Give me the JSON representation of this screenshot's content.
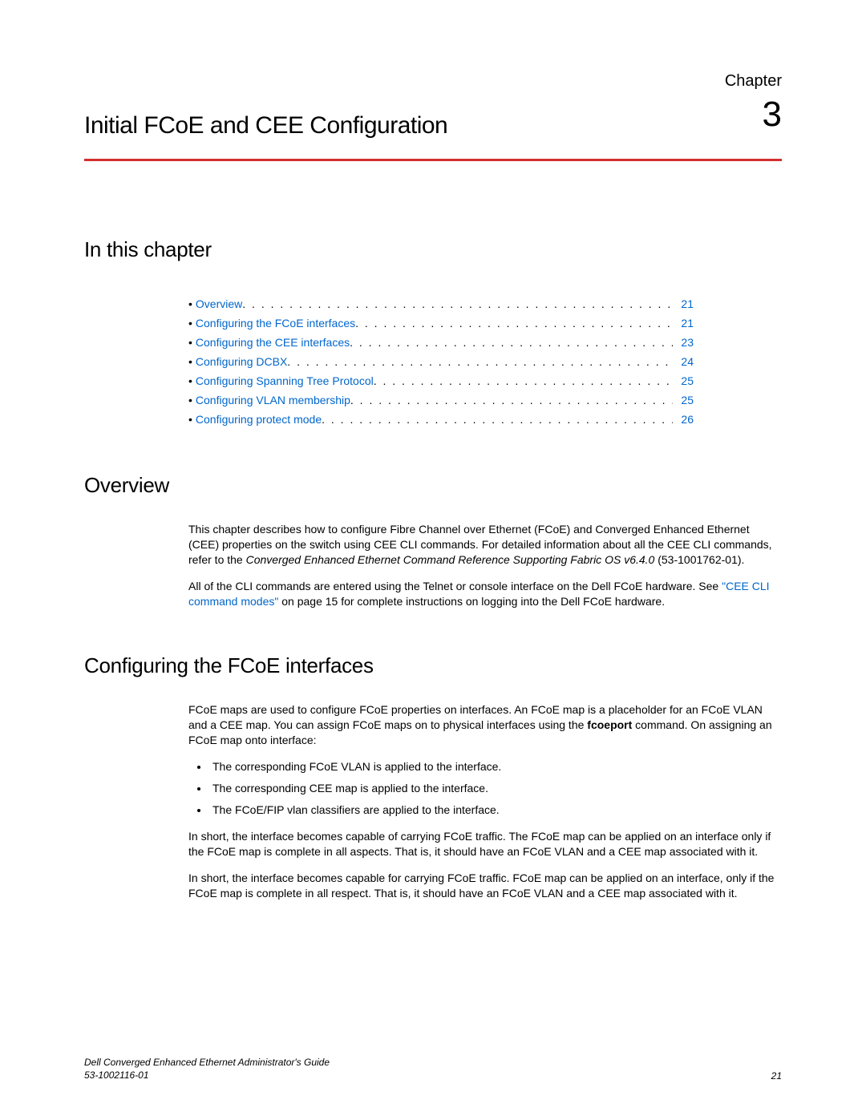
{
  "chapter": {
    "label": "Chapter",
    "number": "3",
    "title": "Initial FCoE and CEE Configuration"
  },
  "headings": {
    "in_this_chapter": "In this chapter",
    "overview": "Overview",
    "configuring_fcoe": "Configuring the FCoE interfaces"
  },
  "toc": [
    {
      "label": "Overview",
      "page": "21"
    },
    {
      "label": "Configuring the FCoE interfaces",
      "page": "21"
    },
    {
      "label": "Configuring the CEE interfaces",
      "page": "23"
    },
    {
      "label": "Configuring DCBX",
      "page": "24"
    },
    {
      "label": "Configuring Spanning Tree Protocol",
      "page": "25"
    },
    {
      "label": "Configuring VLAN membership",
      "page": "25"
    },
    {
      "label": "Configuring protect mode",
      "page": "26"
    }
  ],
  "overview": {
    "p1_a": "This chapter describes how to configure Fibre Channel over Ethernet (FCoE) and Converged Enhanced Ethernet (CEE) properties on the switch using CEE CLI commands. For detailed information about all the CEE CLI commands, refer to the ",
    "p1_italic": "Converged Enhanced Ethernet Command Reference Supporting Fabric OS v6.4.0",
    "p1_b": " (53-1001762-01).",
    "p2_a": "All of the CLI commands are entered using the Telnet or console interface on the Dell FCoE hardware. See ",
    "p2_link": "\"CEE CLI command modes\"",
    "p2_b": " on page 15 for complete instructions on logging into the Dell FCoE hardware."
  },
  "fcoe": {
    "p1_a": "FCoE maps are used to configure FCoE properties on interfaces. An FCoE map is a placeholder for an FCoE VLAN and a CEE map. You can assign FCoE maps on to physical interfaces using the ",
    "p1_bold": "fcoeport",
    "p1_b": " command. On assigning an FCoE map onto interface:",
    "bullets": [
      "The corresponding FCoE VLAN is applied to the interface.",
      "The corresponding CEE map is applied to the interface.",
      "The FCoE/FIP vlan classifiers are applied to the interface."
    ],
    "p2": "In short, the interface becomes capable of carrying FCoE traffic. The FCoE map can be applied on an interface only if the FCoE map is complete in all aspects. That is, it should have an FCoE VLAN and a CEE map associated with it.",
    "p3": "In short, the interface becomes capable for carrying FCoE traffic. FCoE map can be applied on an interface, only if the FCoE map is complete in all respect. That is, it should have an FCoE VLAN and a CEE map associated with it."
  },
  "footer": {
    "title": "Dell Converged Enhanced Ethernet Administrator's Guide",
    "docnum": "53-1002116-01",
    "page": "21"
  }
}
